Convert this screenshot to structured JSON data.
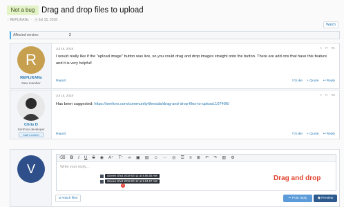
{
  "thread": {
    "prefix": "Not a bug",
    "title": "Drag and drop files to upload",
    "author_meta": "REPLIKANs",
    "date_meta": "Jul 15, 2018",
    "watch_label": "Watch"
  },
  "affected": {
    "label": "Affected version:",
    "value": "2"
  },
  "posts": [
    {
      "avatar_letter": "R",
      "username": "REPLIKANs",
      "user_title": "New member",
      "date": "Jul 15, 2018",
      "number": "#1",
      "body": "I would really like if the \"upload image\" button was live, so you could drag and drop images straight onto the button. There are add ons that have this feature and it is very helpful!",
      "report": "Report",
      "like": "Like",
      "quote": "+ Quote",
      "reply": "Reply"
    },
    {
      "username": "Chris D",
      "user_title": "XenForo developer",
      "user_banner": "Staff member",
      "date": "Jul 15, 2018",
      "number": "#2",
      "body_prefix": "Has been suggested: ",
      "body_link": "https://xenforo.com/community/threads/drag-and-drop-files-to-upload.107406/",
      "report": "Report",
      "like": "Like",
      "quote": "+ Quote",
      "reply": "Reply"
    }
  ],
  "reply_box": {
    "avatar_letter": "V",
    "placeholder": "Write your reply...",
    "toolbar_icons": [
      "eraser-icon",
      "bold-icon",
      "italic-icon",
      "underline-icon",
      "strikethrough-icon",
      "color-icon",
      "font-size-icon",
      "link-icon",
      "image-icon",
      "media-icon",
      "emoji-icon",
      "more-icon",
      "list-icon",
      "align-icon",
      "insert-icon",
      "undo-icon",
      "redo-icon",
      "save-icon",
      "settings-icon"
    ],
    "drag_files": [
      "Screen Shot 2018-03-12 at 8.56.05 AM",
      "Screen Shot 2018-03-12 at 8.54.57 AM"
    ],
    "drag_count": "2",
    "drag_annotation": "Drag and drop",
    "attach_label": "Attach files",
    "post_reply_label": "Post reply",
    "preview_label": "Preview"
  },
  "colors": {
    "link": "#2577b1",
    "annotation": "#e0442f",
    "prefix_bg": "#e4f2c7",
    "post_reply_bg": "#5b9bd9",
    "preview_bg": "#2c5a8f"
  }
}
